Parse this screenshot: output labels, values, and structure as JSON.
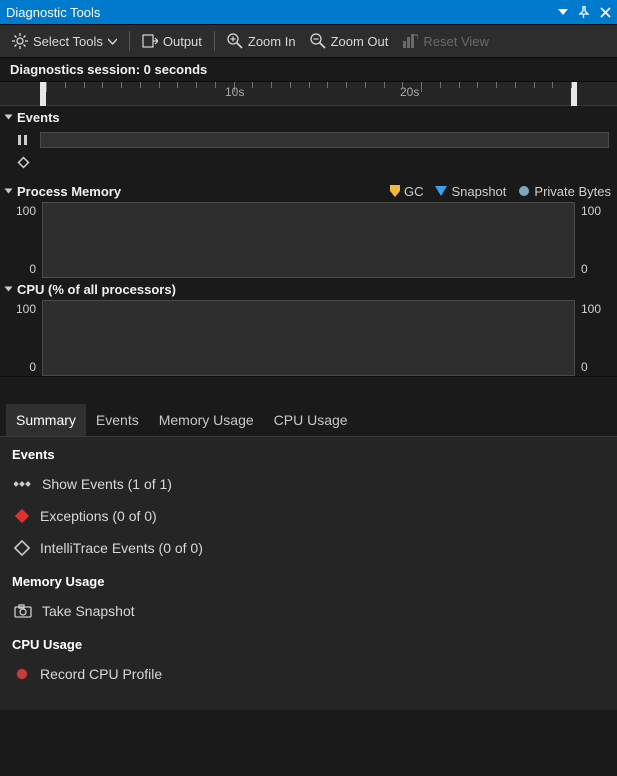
{
  "window": {
    "title": "Diagnostic Tools"
  },
  "toolbar": {
    "select_tools": "Select Tools",
    "output": "Output",
    "zoom_in": "Zoom In",
    "zoom_out": "Zoom Out",
    "reset_view": "Reset View"
  },
  "session": {
    "label": "Diagnostics session: 0 seconds"
  },
  "timeline": {
    "ticks": [
      "10s",
      "20s"
    ]
  },
  "sections": {
    "events": {
      "title": "Events"
    },
    "memory": {
      "title": "Process Memory",
      "legend": {
        "gc": "GC",
        "snapshot": "Snapshot",
        "private_bytes": "Private Bytes"
      },
      "axis_top": "100",
      "axis_bottom": "0"
    },
    "cpu": {
      "title": "CPU (% of all processors)",
      "axis_top": "100",
      "axis_bottom": "0"
    }
  },
  "tabs": {
    "summary": "Summary",
    "events": "Events",
    "memory": "Memory Usage",
    "cpu": "CPU Usage"
  },
  "summary": {
    "events_hdr": "Events",
    "show_events": "Show Events (1 of 1)",
    "exceptions": "Exceptions (0 of 0)",
    "intellitrace": "IntelliTrace Events (0 of 0)",
    "memory_hdr": "Memory Usage",
    "take_snapshot": "Take Snapshot",
    "cpu_hdr": "CPU Usage",
    "record_cpu": "Record CPU Profile"
  },
  "colors": {
    "accent": "#007acc",
    "gc": "#f5b83d",
    "snapshot": "#3aa0e8",
    "private_bytes": "#7aa7c7",
    "record": "#c04040",
    "exception_red": "#e03030"
  },
  "chart_data": [
    {
      "type": "line",
      "title": "Process Memory",
      "series": [
        {
          "name": "Private Bytes",
          "values": []
        }
      ],
      "ylim": [
        0,
        100
      ],
      "ylabel": "",
      "xlabel": "seconds"
    },
    {
      "type": "area",
      "title": "CPU (% of all processors)",
      "series": [
        {
          "name": "CPU",
          "values": []
        }
      ],
      "ylim": [
        0,
        100
      ],
      "ylabel": "%",
      "xlabel": "seconds"
    }
  ]
}
